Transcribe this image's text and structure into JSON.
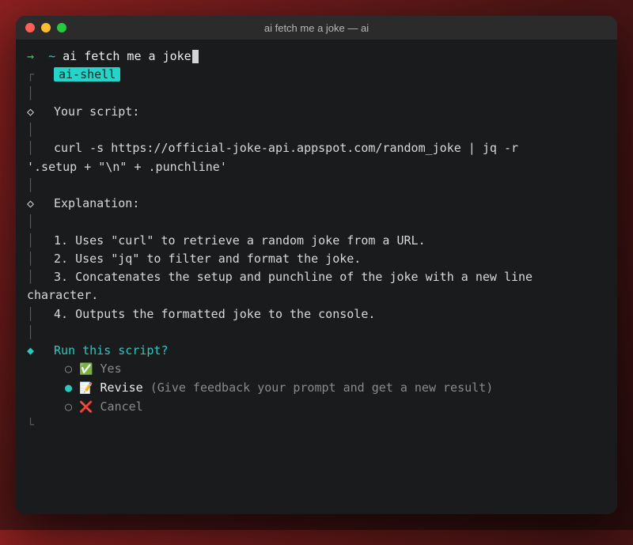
{
  "window": {
    "title": "ai fetch me a joke — ai"
  },
  "prompt": {
    "arrow": "→",
    "tilde": "~",
    "command": "ai fetch me a joke"
  },
  "tag": {
    "label": "ai-shell"
  },
  "script": {
    "heading": "Your script:",
    "body_line1": "curl -s https://official-joke-api.appspot.com/random_joke | jq -r",
    "body_line2": "'.setup + \"\\n\" + .punchline'"
  },
  "explanation": {
    "heading": "Explanation:",
    "items": [
      "1. Uses \"curl\" to retrieve a random joke from a URL.",
      "2. Uses \"jq\" to filter and format the joke.",
      "3. Concatenates the setup and punchline of the joke with a new line character.",
      "4. Outputs the formatted joke to the console."
    ]
  },
  "run_prompt": {
    "question": "Run this script?",
    "options": [
      {
        "marker": "○",
        "emoji": "✅",
        "label": "Yes",
        "hint": "",
        "selected": false
      },
      {
        "marker": "●",
        "emoji": "📝",
        "label": "Revise",
        "hint": "(Give feedback your prompt and get a new result)",
        "selected": true
      },
      {
        "marker": "○",
        "emoji": "❌",
        "label": "Cancel",
        "hint": "",
        "selected": false
      }
    ]
  }
}
